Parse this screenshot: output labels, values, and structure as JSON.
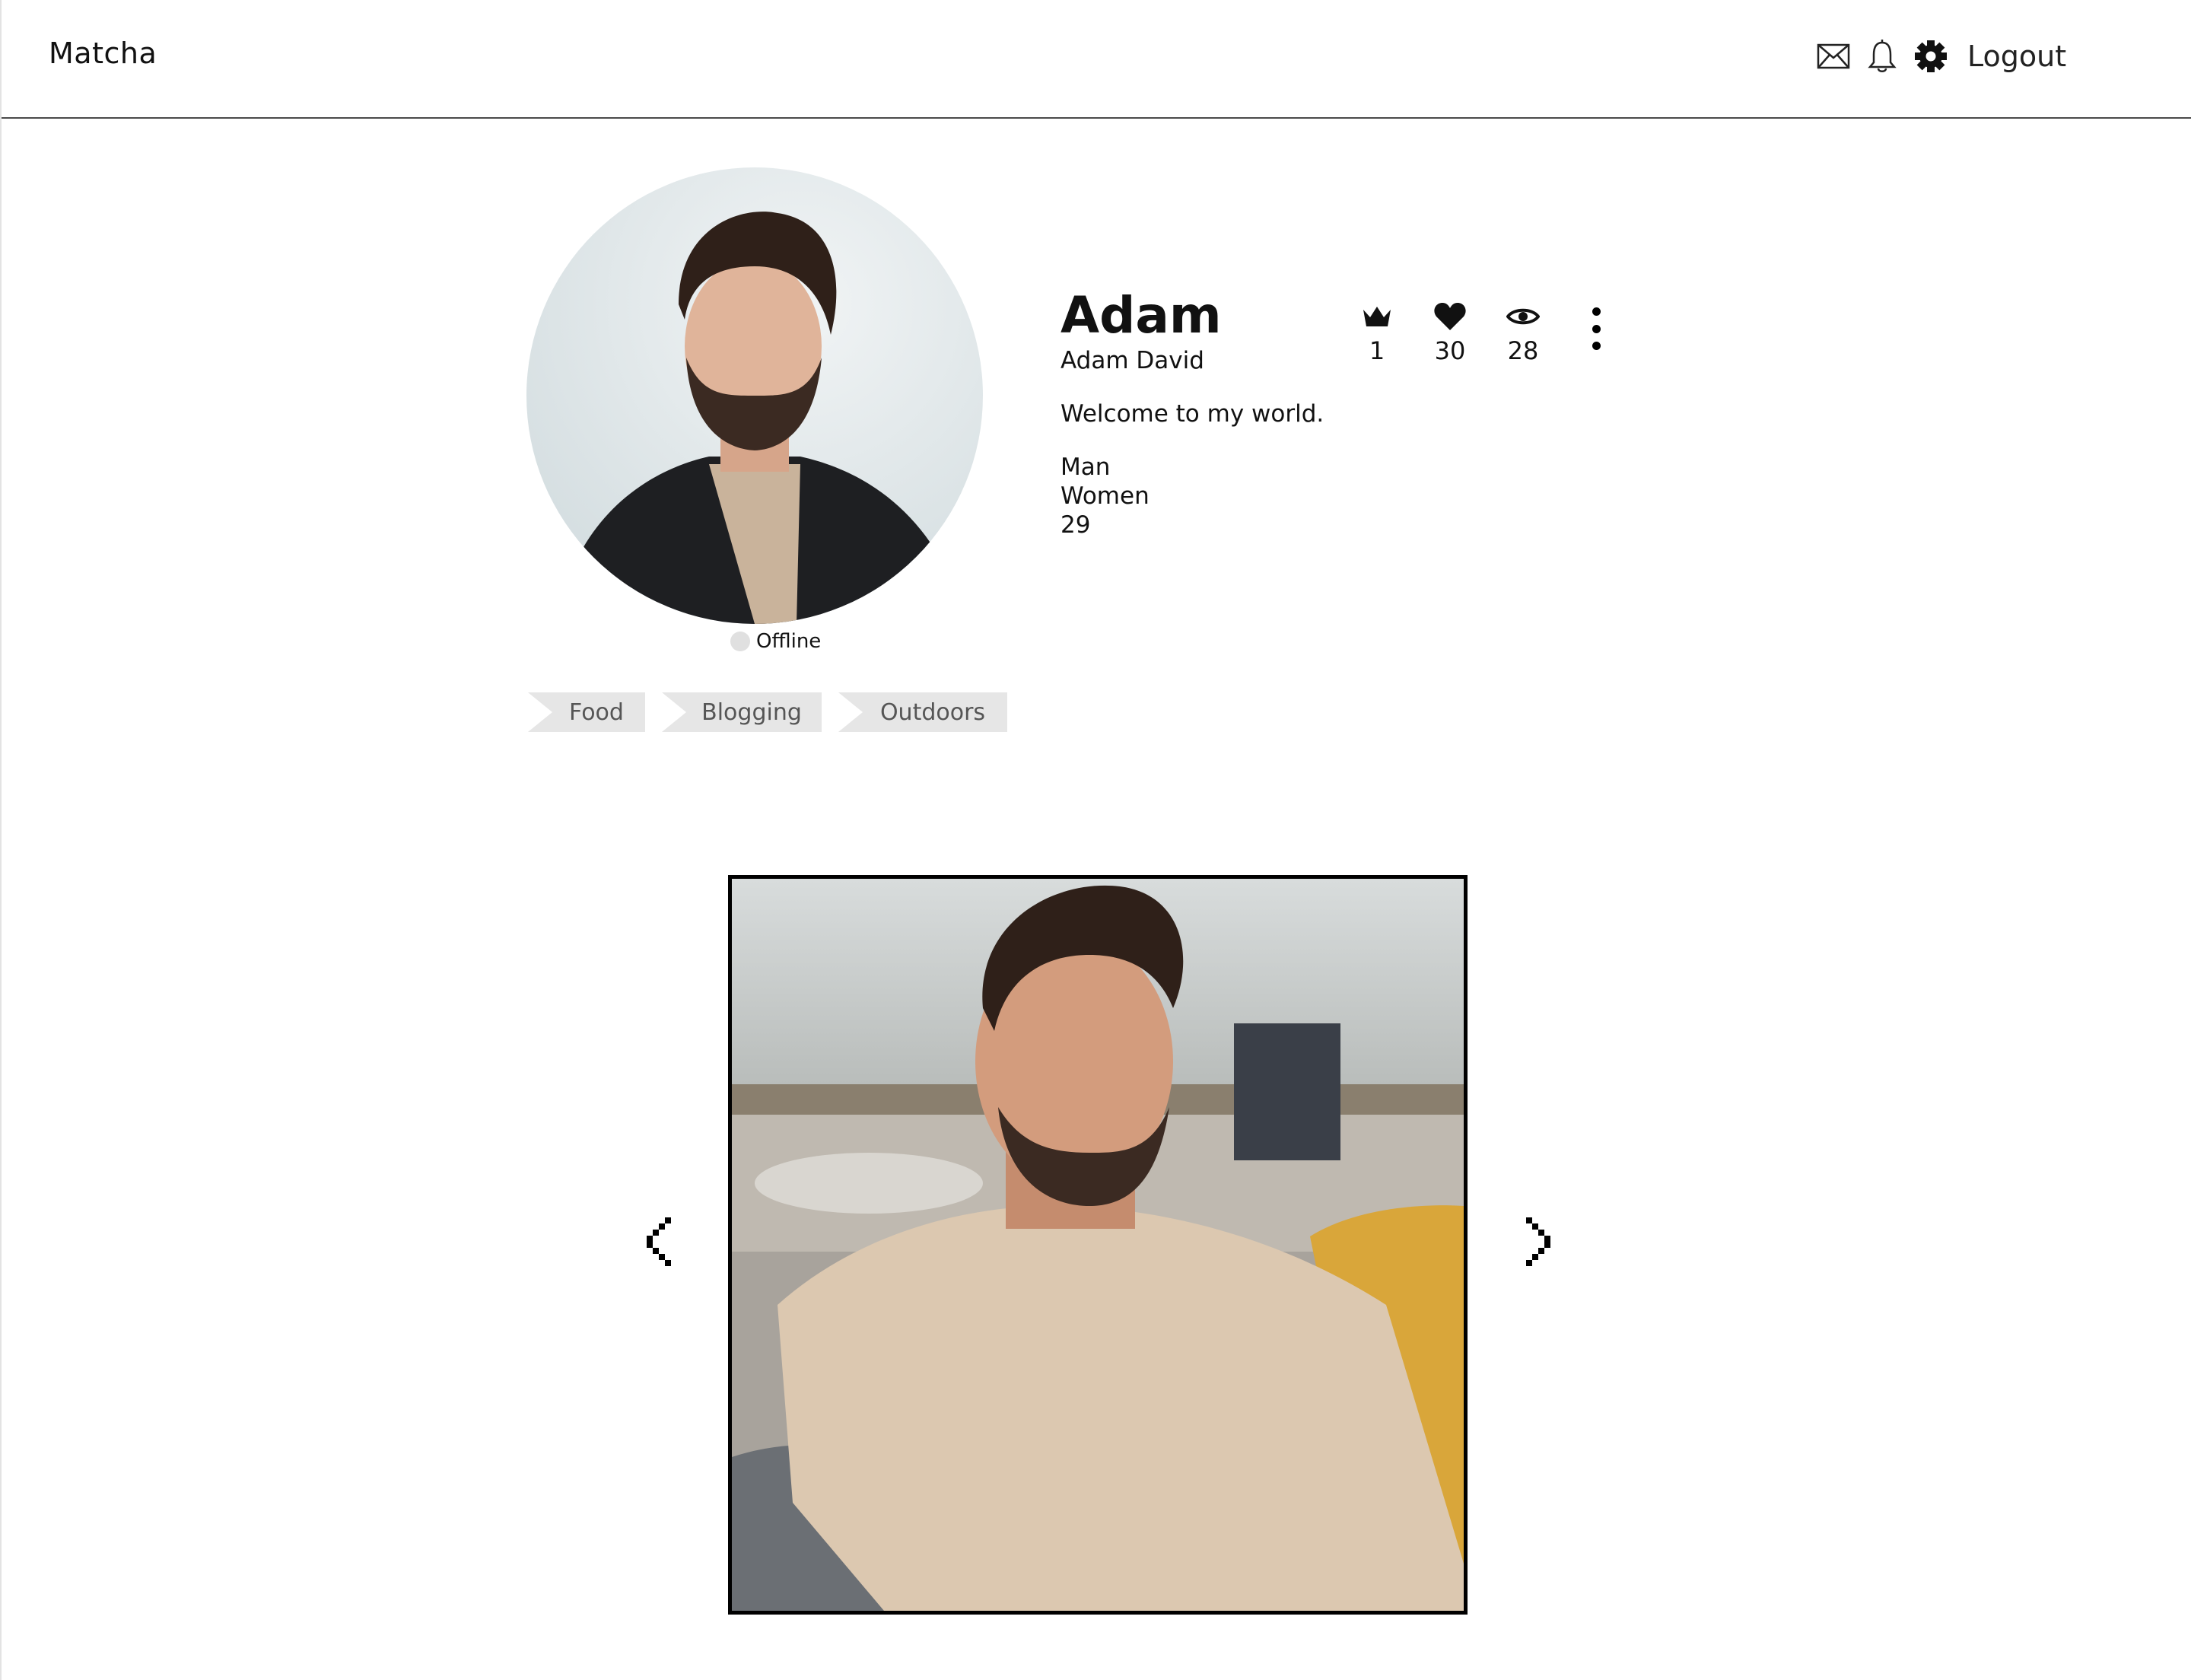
{
  "header": {
    "brand": "Matcha",
    "logout_label": "Logout",
    "icons": [
      "mail-icon",
      "bell-icon",
      "gear-icon"
    ]
  },
  "profile": {
    "first_name": "Adam",
    "full_name": "Adam David",
    "bio": "Welcome to my world.",
    "gender": "Man",
    "preference": "Women",
    "age": "29",
    "status": "Offline",
    "tags": [
      "Food",
      "Blogging",
      "Outdoors"
    ],
    "stats": {
      "rank": "1",
      "likes": "30",
      "views": "28"
    }
  },
  "gallery": {
    "prev_icon": "chevron-left-icon",
    "next_icon": "chevron-right-icon"
  },
  "colors": {
    "tag_bg": "#e6e6e6",
    "status_offline": "#e0e0e0",
    "border": "#000000"
  }
}
